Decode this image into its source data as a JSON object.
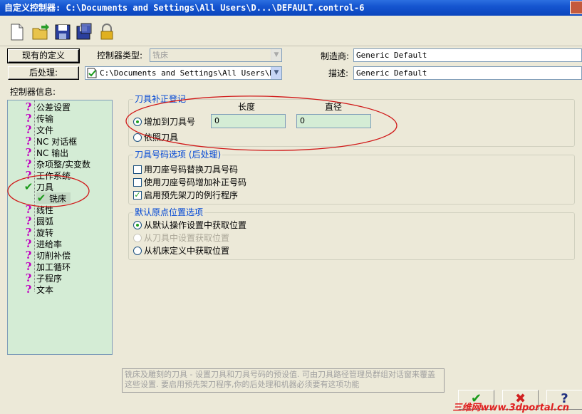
{
  "window": {
    "title": "自定义控制器: C:\\Documents and Settings\\All Users\\D...\\DEFAULT.control-6"
  },
  "toolbar": {
    "icons": [
      "new-file-icon",
      "open-folder-icon",
      "save-icon",
      "save-as-icon",
      "lock-icon"
    ]
  },
  "top": {
    "existing_def_button": "现有的定义",
    "post_button": "后处理:",
    "controller_type_label": "控制器类型:",
    "controller_type_value": "铣床",
    "post_path": "C:\\Documents and Settings\\All Users\\Doc",
    "manufacturer_label": "制造商:",
    "manufacturer_value": "Generic Default",
    "description_label": "描述:",
    "description_value": "Generic Default"
  },
  "tree": {
    "label": "控制器信息:",
    "items": [
      {
        "text": "公差设置",
        "icon": "question"
      },
      {
        "text": "传输",
        "icon": "question"
      },
      {
        "text": "文件",
        "icon": "question"
      },
      {
        "text": "NC 对话框",
        "icon": "question"
      },
      {
        "text": "NC 输出",
        "icon": "question"
      },
      {
        "text": "杂项整/实变数",
        "icon": "question"
      },
      {
        "text": "工作系统",
        "icon": "question"
      },
      {
        "text": "刀具",
        "icon": "check"
      },
      {
        "text": "铣床",
        "icon": "check"
      },
      {
        "text": "线性",
        "icon": "question"
      },
      {
        "text": "圆弧",
        "icon": "question"
      },
      {
        "text": "旋转",
        "icon": "question"
      },
      {
        "text": "进给率",
        "icon": "question"
      },
      {
        "text": "切削补偿",
        "icon": "question"
      },
      {
        "text": "加工循环",
        "icon": "question"
      },
      {
        "text": "子程序",
        "icon": "question"
      },
      {
        "text": "文本",
        "icon": "question"
      }
    ]
  },
  "offset_group": {
    "title": "刀具补正登记",
    "col_length": "长度",
    "col_diameter": "直径",
    "radio_add": "增加到刀具号",
    "radio_follow": "依照刀具",
    "length_value": "0",
    "diameter_value": "0"
  },
  "toolnum_group": {
    "title": "刀具号码选项 (后处理)",
    "cb1": "用刀座号码替换刀具号码",
    "cb2": "使用刀座号码增加补正号码",
    "cb3": "启用预先架刀的例行程序"
  },
  "origin_group": {
    "title": "默认原点位置选项",
    "r1": "从默认操作设置中获取位置",
    "r2": "从刀具中设置获取位置",
    "r3": "从机床定义中获取位置"
  },
  "description_text": "铣床及雕刻的刀具 - 设置刀具和刀具号码的预设值. 可由刀具路径管理员群组对话窗来覆盖这些设置. 要启用预先架刀程序,你的后处理和机器必须要有这项功能",
  "buttons": {
    "ok": "✔",
    "cancel": "✖",
    "help": "?"
  },
  "watermark": "三维网www.3dportal.cn",
  "colors": {
    "accent": "#0046d5",
    "annotation": "#d01818",
    "tree_bg": "#d4ecd5"
  }
}
